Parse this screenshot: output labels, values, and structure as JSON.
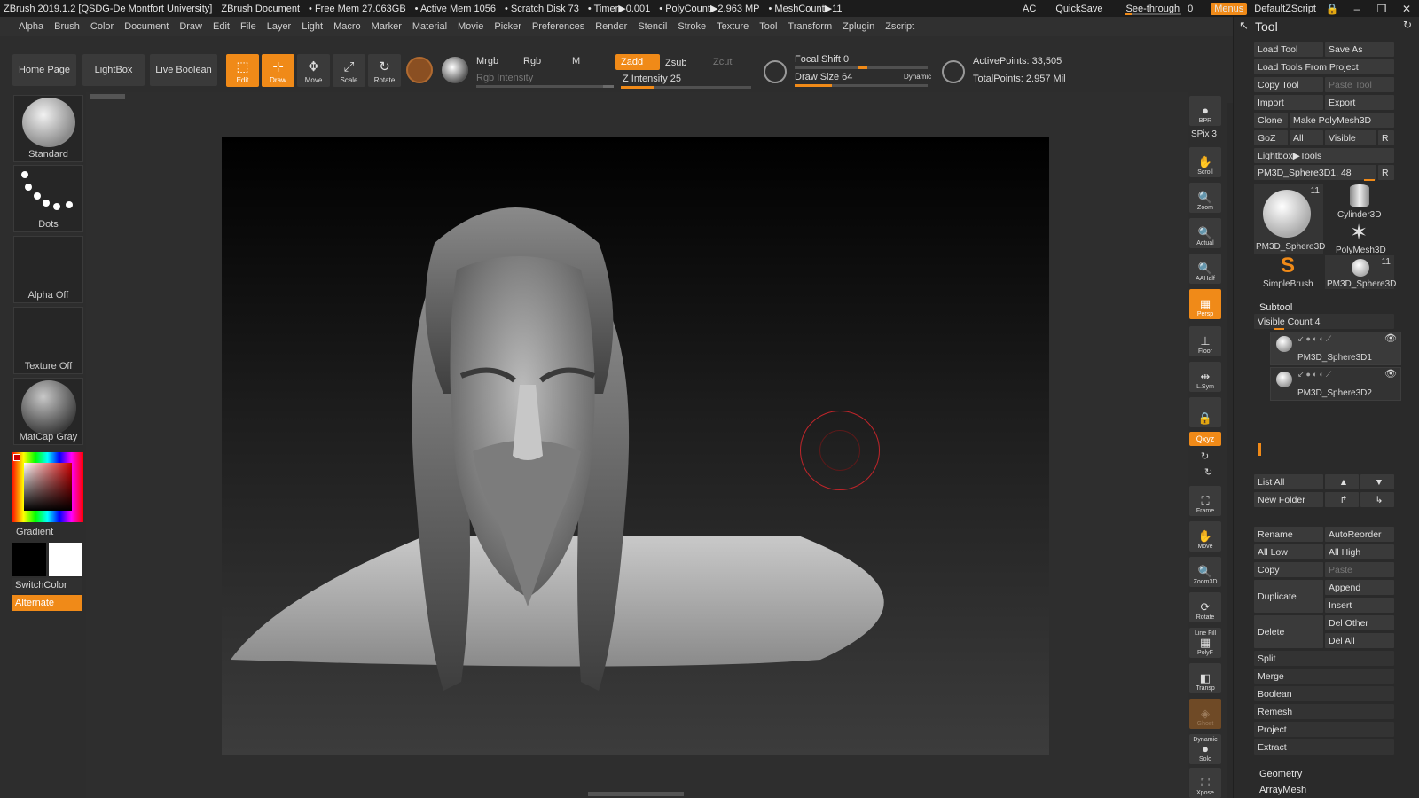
{
  "titlebar": {
    "app": "ZBrush 2019.1.2 [QSDG-De Montfort University]",
    "document": "ZBrush Document",
    "free_mem": "• Free Mem 27.063GB",
    "active_mem": "• Active Mem 1056",
    "scratch": "• Scratch Disk 73",
    "timer": "• Timer▶0.001",
    "polycount": "• PolyCount▶2.963 MP",
    "meshcount": "• MeshCount▶11",
    "ac": "AC",
    "quicksave": "QuickSave",
    "see_through_label": "See-through",
    "see_through_value": "0",
    "menus": "Menus",
    "script": "DefaultZScript"
  },
  "menubar": [
    "Alpha",
    "Brush",
    "Color",
    "Document",
    "Draw",
    "Edit",
    "File",
    "Layer",
    "Light",
    "Macro",
    "Marker",
    "Material",
    "Movie",
    "Picker",
    "Preferences",
    "Render",
    "Stencil",
    "Stroke",
    "Texture",
    "Tool",
    "Transform",
    "Zplugin",
    "Zscript"
  ],
  "shelf": {
    "home": "Home Page",
    "lightbox": "LightBox",
    "live_boolean": "Live Boolean",
    "edit": "Edit",
    "draw": "Draw",
    "move": "Move",
    "scale": "Scale",
    "rotate": "Rotate",
    "mrgb": "Mrgb",
    "rgb": "Rgb",
    "m": "M",
    "rgb_intensity": "Rgb Intensity",
    "zadd": "Zadd",
    "zsub": "Zsub",
    "zcut": "Zcut",
    "z_intensity": "Z Intensity 25",
    "z_intensity_level": 0.25,
    "focal_shift": "Focal Shift 0",
    "draw_size": "Draw Size 64",
    "dynamic": "Dynamic",
    "active_points": "ActivePoints: 33,505",
    "total_points": "TotalPoints: 2.957 Mil"
  },
  "leftpanel": {
    "brush": "Standard",
    "stroke": "Dots",
    "alpha": "Alpha Off",
    "texture": "Texture Off",
    "material": "MatCap Gray",
    "gradient": "Gradient",
    "switchcolor": "SwitchColor",
    "alternate": "Alternate"
  },
  "rightshelf": {
    "bpr": "BPR",
    "spix": "SPix 3",
    "scroll": "Scroll",
    "zoom": "Zoom",
    "actual": "Actual",
    "aahalf": "AAHalf",
    "persp": "Persp",
    "floor": "Floor",
    "lsym": "L.Sym",
    "xyz": "Qxyz",
    "frame": "Frame",
    "move": "Move",
    "zoom3d": "Zoom3D",
    "rotate": "Rotate",
    "linefill": "Line Fill",
    "polyf": "PolyF",
    "transp": "Transp",
    "ghost": "Ghost",
    "dynamic": "Dynamic",
    "solo": "Solo",
    "xpose": "Xpose"
  },
  "toolpanel": {
    "title": "Tool",
    "load_tool": "Load Tool",
    "save_as": "Save As",
    "load_from_project": "Load Tools From Project",
    "copy_tool": "Copy Tool",
    "paste_tool": "Paste Tool",
    "import": "Import",
    "export": "Export",
    "clone": "Clone",
    "make_polymesh": "Make PolyMesh3D",
    "goz": "GoZ",
    "all": "All",
    "visible": "Visible",
    "r": "R",
    "lightbox_tools": "Lightbox▶Tools",
    "current_tool": "PM3D_Sphere3D1. 48",
    "thumbs": [
      "PM3D_Sphere3D",
      "Cylinder3D",
      "PolyMesh3D",
      "SimpleBrush",
      "PM3D_Sphere3D"
    ],
    "thumb_count_1": "11",
    "thumb_count_2": "11",
    "subtool": "Subtool",
    "visible_count": "Visible Count 4",
    "subtools": [
      "PM3D_Sphere3D1",
      "PM3D_Sphere3D2"
    ],
    "list_all": "List All",
    "new_folder": "New Folder",
    "rename": "Rename",
    "autoreorder": "AutoReorder",
    "all_low": "All Low",
    "all_high": "All High",
    "copy": "Copy",
    "paste": "Paste",
    "duplicate": "Duplicate",
    "append": "Append",
    "insert": "Insert",
    "delete": "Delete",
    "del_other": "Del Other",
    "del_all": "Del All",
    "split": "Split",
    "merge": "Merge",
    "boolean": "Boolean",
    "remesh": "Remesh",
    "project": "Project",
    "extract": "Extract",
    "geometry": "Geometry",
    "arraymesh": "ArrayMesh"
  }
}
